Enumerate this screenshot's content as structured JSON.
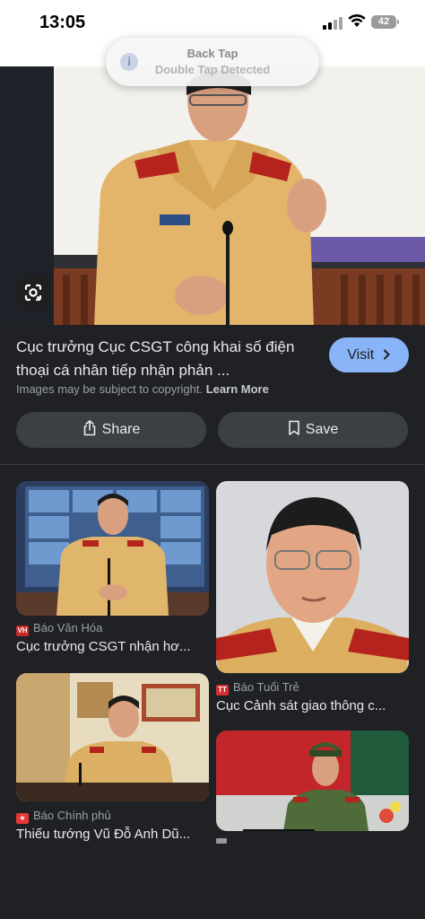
{
  "status": {
    "time": "13:05",
    "battery": "42"
  },
  "toast": {
    "title": "Back Tap",
    "subtitle": "Double Tap Detected"
  },
  "result": {
    "caption": "Cục trưởng Cục CSGT công khai số điện thoại cá nhân tiếp nhận phản ...",
    "visit_label": "Visit",
    "copyright_text": "Images may be subject to copyright.",
    "learn_more": "Learn More",
    "share_label": "Share",
    "save_label": "Save"
  },
  "related": [
    {
      "source": "Báo Văn Hóa",
      "title": "Cục trưởng CSGT nhận hơ...",
      "favicon_color": "#c62828",
      "favicon_text": "VH"
    },
    {
      "source": "Báo Tuổi Trẻ",
      "title": "Cục Cảnh sát giao thông c...",
      "favicon_color": "#d32f2f",
      "favicon_text": "TT"
    },
    {
      "source": "Báo Chính phủ",
      "title": "Thiếu tướng Vũ Đỗ Anh Dũ...",
      "favicon_color": "#e53935",
      "favicon_text": "★"
    }
  ],
  "icons": {
    "lens": "google-lens-icon",
    "share": "share-icon",
    "save": "bookmark-icon",
    "visit_arrow": "chevron-right-icon"
  },
  "colors": {
    "background": "#202124",
    "accent": "#8ab4f8",
    "pill": "#3c4043"
  }
}
